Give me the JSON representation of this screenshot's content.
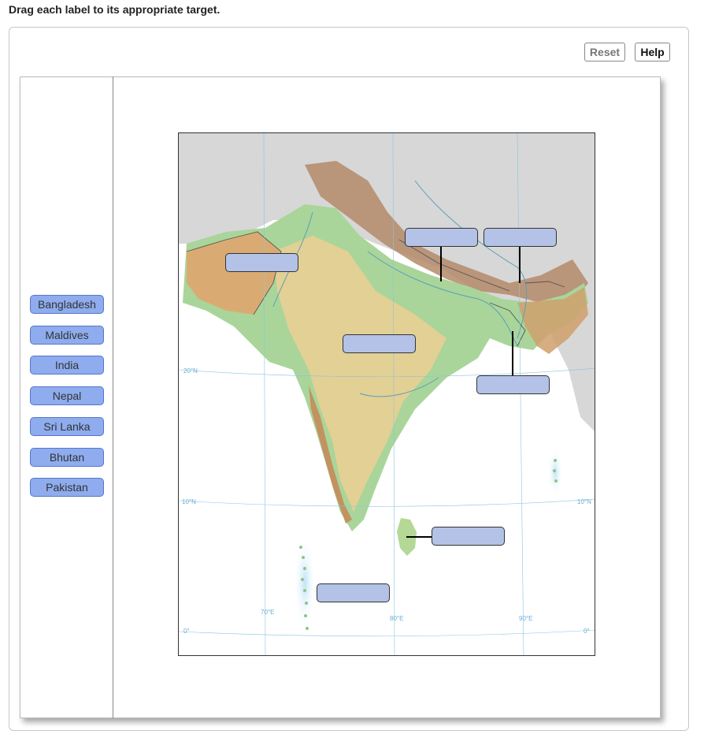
{
  "instruction": "Drag each label to its appropriate target.",
  "toolbar": {
    "reset_label": "Reset",
    "help_label": "Help"
  },
  "labels": [
    "Bangladesh",
    "Maldives",
    "India",
    "Nepal",
    "Sri Lanka",
    "Bhutan",
    "Pakistan"
  ],
  "map": {
    "lat_labels": [
      "20°N",
      "10°N",
      "10°N",
      "0°",
      "0°"
    ],
    "lon_labels": [
      "70°E",
      "80°E",
      "90°E"
    ]
  },
  "colors": {
    "chip_fill": "#8eacee",
    "chip_border": "#5577cc",
    "target_fill": "#b3c2e6",
    "ocean": "#ffffff",
    "land_low": "#a8d5a0",
    "land_plateau": "#e8c88e",
    "land_high": "#b9835b",
    "mountain_snow": "#cfcfcf"
  }
}
